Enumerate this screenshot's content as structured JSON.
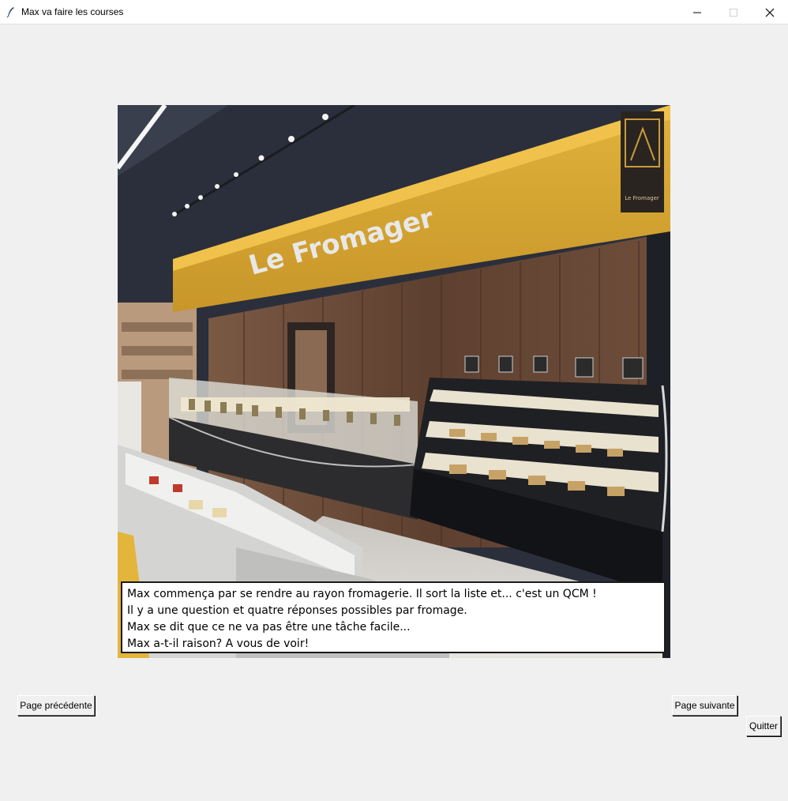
{
  "window": {
    "title": "Max va faire les courses",
    "controls": {
      "minimize_icon": "minimize-icon",
      "maximize_icon": "maximize-icon",
      "close_icon": "close-icon"
    }
  },
  "scene": {
    "sign_text": "Le Fromager",
    "emblem_text": "Le Fromager",
    "colors": {
      "banner": "#d9a630",
      "wood": "#6b4a36",
      "ceiling": "#2b2f3b",
      "floor": "#d8d6d2"
    }
  },
  "caption": {
    "lines": [
      "Max commença par se rendre au rayon fromagerie. Il sort la liste et... c'est un QCM !",
      "Il y a une question et quatre réponses possibles par fromage.",
      "Max se dit que ce ne va pas être une tâche facile...",
      "Max a-t-il raison? A vous de voir!"
    ]
  },
  "buttons": {
    "previous": "Page précédente",
    "next": "Page suivante",
    "quit": "Quitter"
  }
}
